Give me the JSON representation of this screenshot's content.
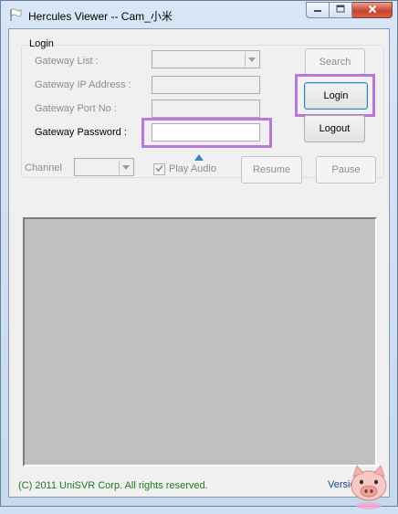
{
  "window": {
    "title": "Hercules Viewer -- Cam_小米",
    "icons": {
      "app": "flag-icon",
      "minimize": "minimize-icon",
      "maximize": "maximize-icon",
      "close": "close-icon"
    }
  },
  "login": {
    "group_label": "Login",
    "gateway_list_label": "Gateway List :",
    "gateway_list_value": "",
    "gateway_ip_label": "Gateway IP Address :",
    "gateway_ip_value": "",
    "gateway_port_label": "Gateway Port No :",
    "gateway_port_value": "",
    "gateway_password_label": "Gateway Password :",
    "gateway_password_value": "",
    "search_label": "Search",
    "login_label": "Login",
    "logout_label": "Logout"
  },
  "controls": {
    "channel_label": "Channel",
    "channel_value": "",
    "play_audio_label": "Play Audio",
    "play_audio_checked": true,
    "resume_label": "Resume",
    "pause_label": "Pause"
  },
  "footer": {
    "copyright": "(C) 2011 UniSVR Corp. All rights reserved.",
    "version": "Version"
  },
  "colors": {
    "highlight": "#b878d8",
    "copyright": "#1b7a1b",
    "version": "#1d3f8a",
    "video_bg": "#c0c0c0",
    "close_button": "#c8452c"
  }
}
